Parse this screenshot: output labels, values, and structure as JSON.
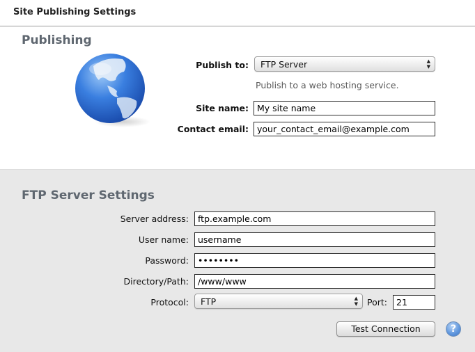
{
  "header": {
    "title": "Site Publishing Settings"
  },
  "publishing": {
    "title": "Publishing",
    "globe_icon": "globe-icon",
    "publish_to_label": "Publish to:",
    "publish_to_value": "FTP Server",
    "publish_to_hint": "Publish to a web hosting service.",
    "site_name_label": "Site name:",
    "site_name_value": "My site name",
    "contact_email_label": "Contact email:",
    "contact_email_value": "your_contact_email@example.com"
  },
  "ftp": {
    "title": "FTP Server Settings",
    "server_address_label": "Server address:",
    "server_address_value": "ftp.example.com",
    "user_name_label": "User name:",
    "user_name_value": "username",
    "password_label": "Password:",
    "password_value": "••••••••",
    "directory_label": "Directory/Path:",
    "directory_value": "/www/www",
    "protocol_label": "Protocol:",
    "protocol_value": "FTP",
    "port_label": "Port:",
    "port_value": "21",
    "test_button": "Test Connection",
    "help_glyph": "?"
  },
  "popup_arrows": "▲\n▼"
}
